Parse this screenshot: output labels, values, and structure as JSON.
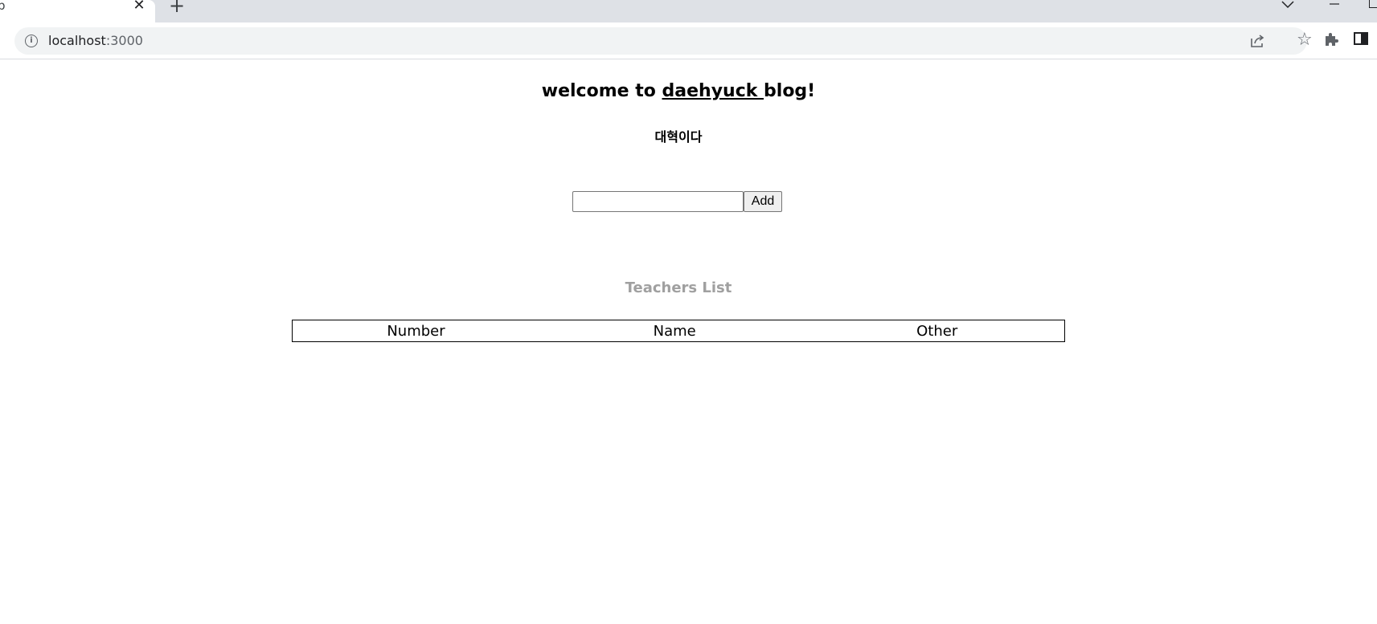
{
  "browser": {
    "tab_title": "p",
    "tab_close": "✕",
    "new_tab": "+",
    "url_host": "localhost",
    "url_port": ":3000"
  },
  "page": {
    "title_prefix": "welcome to ",
    "title_link": "daehyuck ",
    "title_suffix": "blog!",
    "subtitle": "대혁이다",
    "input_value": "",
    "add_button": "Add",
    "list_title": "Teachers List",
    "table_headers": [
      "Number",
      "Name",
      "Other"
    ]
  }
}
